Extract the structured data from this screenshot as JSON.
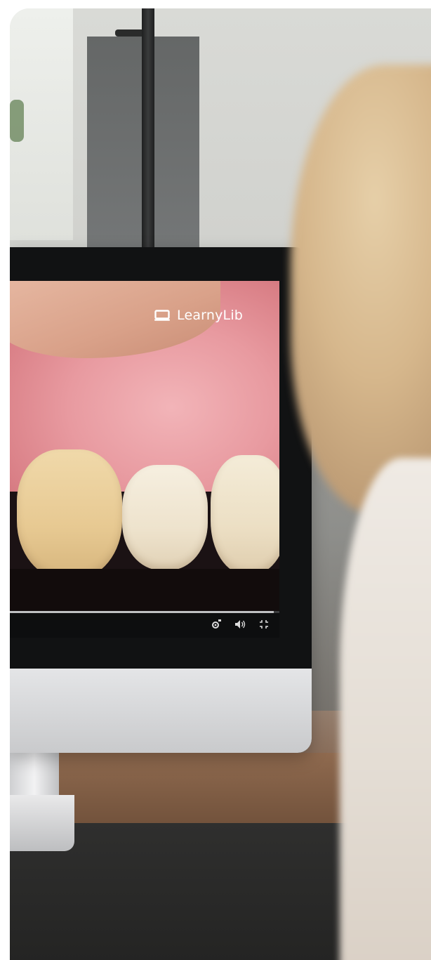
{
  "brand": {
    "name": "LearnyLib",
    "icon": "monitor-icon"
  },
  "player": {
    "progress": 0.98,
    "controls": [
      {
        "name": "settings-hd-icon"
      },
      {
        "name": "volume-icon"
      },
      {
        "name": "fullscreen-icon"
      }
    ]
  },
  "colors": {
    "screen_bezel": "#111213",
    "control_bar": "#0d0e0f",
    "brand_text": "#ffffff"
  }
}
